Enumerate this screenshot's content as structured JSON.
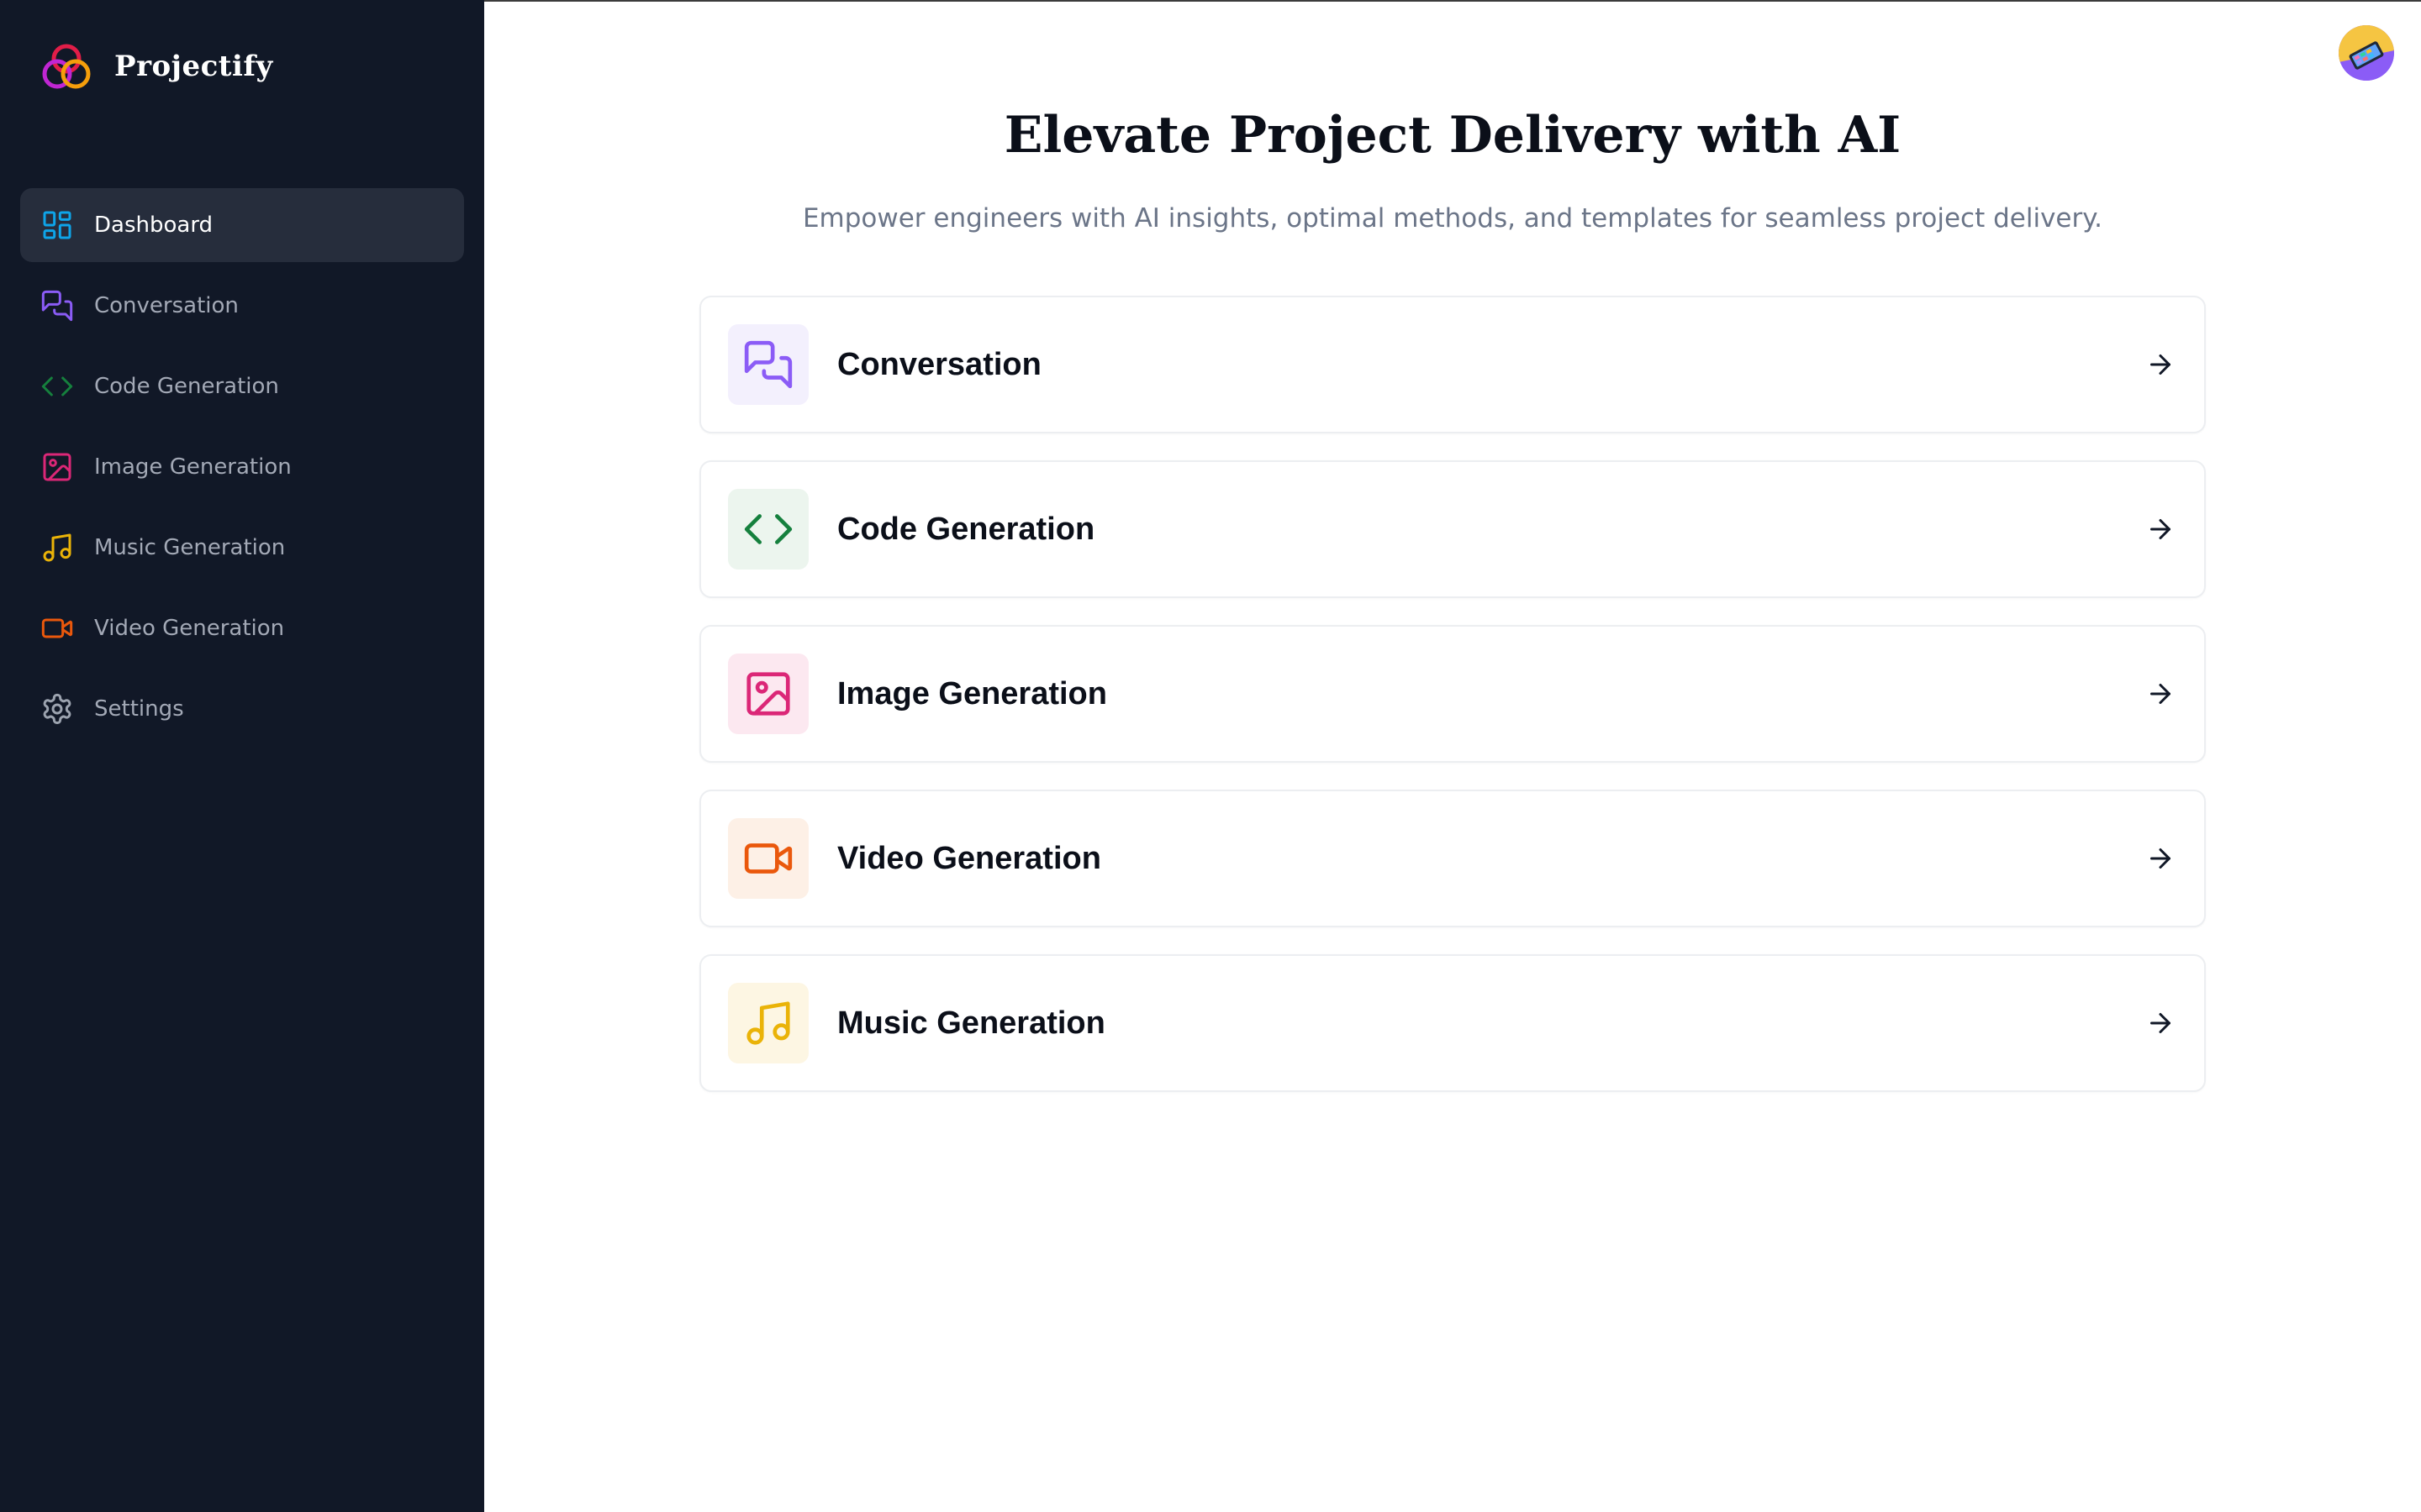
{
  "brand": {
    "name": "Projectify"
  },
  "sidebar": {
    "items": [
      {
        "label": "Dashboard",
        "icon": "dashboard-icon",
        "color": "#0ea5e9",
        "active": true
      },
      {
        "label": "Conversation",
        "icon": "chat-icon",
        "color": "#8b5cf6"
      },
      {
        "label": "Code Generation",
        "icon": "code-icon",
        "color": "#15803d"
      },
      {
        "label": "Image Generation",
        "icon": "image-icon",
        "color": "#db2777"
      },
      {
        "label": "Music Generation",
        "icon": "music-icon",
        "color": "#eab308"
      },
      {
        "label": "Video Generation",
        "icon": "video-icon",
        "color": "#ea580c"
      },
      {
        "label": "Settings",
        "icon": "gear-icon",
        "color": "#9ca3af"
      }
    ]
  },
  "main": {
    "title": "Elevate Project Delivery with AI",
    "subtitle": "Empower engineers with AI insights, optimal methods, and templates for seamless project delivery.",
    "cards": [
      {
        "label": "Conversation",
        "icon": "chat-icon",
        "color": "#8b5cf6",
        "bg": "#f3f0fd"
      },
      {
        "label": "Code Generation",
        "icon": "code-icon",
        "color": "#15803d",
        "bg": "#ecf5ee"
      },
      {
        "label": "Image Generation",
        "icon": "image-icon",
        "color": "#db2777",
        "bg": "#fce8f0"
      },
      {
        "label": "Video Generation",
        "icon": "video-icon",
        "color": "#ea580c",
        "bg": "#fdf0e6"
      },
      {
        "label": "Music Generation",
        "icon": "music-icon",
        "color": "#eab308",
        "bg": "#fdf6e3"
      }
    ]
  },
  "colors": {
    "sidebar_bg": "#111827",
    "active_bg": "#262d3c",
    "text_dark": "#0b0f19",
    "text_muted": "#6b7588"
  }
}
